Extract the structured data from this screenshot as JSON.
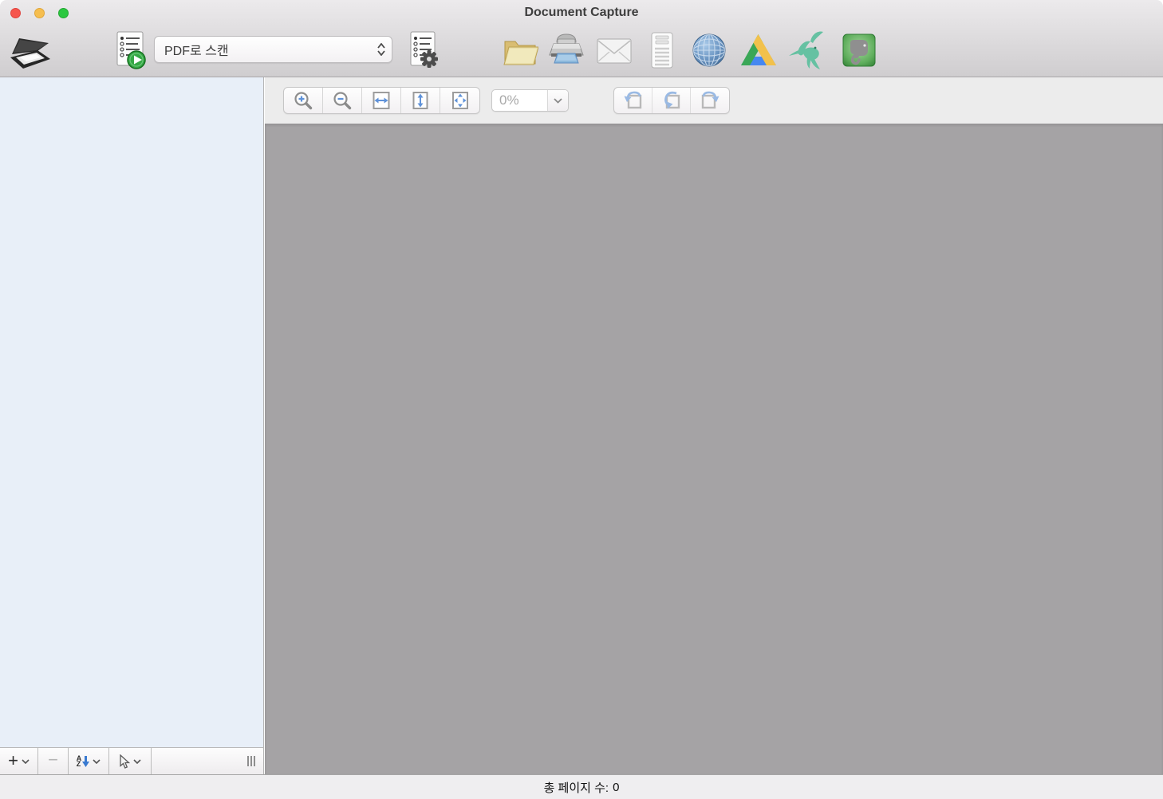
{
  "window": {
    "title": "Document Capture",
    "traffic_lights": {
      "close_color": "#f6554d",
      "minimize_color": "#f6be4f",
      "zoom_color": "#2bc840"
    }
  },
  "toolbar": {
    "scan_button": {
      "icon": "scanner-icon"
    },
    "run_job_button": {
      "icon": "job-run-icon"
    },
    "job_select": {
      "value": "PDF로 스캔"
    },
    "job_settings_button": {
      "icon": "job-settings-icon"
    },
    "destinations": [
      {
        "name": "save-to-folder",
        "icon": "folder-icon",
        "color": "#e8d28e"
      },
      {
        "name": "print",
        "icon": "printer-icon",
        "color": "#9a9a9a"
      },
      {
        "name": "attach-to-email",
        "icon": "envelope-icon",
        "color": "#efefef"
      },
      {
        "name": "send-to-application",
        "icon": "application-icon",
        "color": "#f5f5f5"
      },
      {
        "name": "send-to-web",
        "icon": "globe-icon",
        "color": "#5d8cc0"
      },
      {
        "name": "google-drive",
        "icon": "google-drive-icon",
        "colors": [
          "#3aa757",
          "#f2c14b",
          "#4688f1"
        ]
      },
      {
        "name": "hummingbird-service",
        "icon": "hummingbird-icon",
        "color": "#66c1a2"
      },
      {
        "name": "evernote",
        "icon": "evernote-icon",
        "color": "#57a557"
      }
    ]
  },
  "preview_toolbar": {
    "zoom_in": {
      "icon": "zoom-in-icon"
    },
    "zoom_out": {
      "icon": "zoom-out-icon"
    },
    "fit_width": {
      "icon": "fit-width-icon"
    },
    "fit_height": {
      "icon": "fit-height-icon"
    },
    "fit_page": {
      "icon": "fit-page-icon"
    },
    "zoom_value": "0%",
    "rotate_left": {
      "icon": "rotate-left-icon"
    },
    "rotate_180": {
      "icon": "rotate-180-icon"
    },
    "rotate_right": {
      "icon": "rotate-right-icon"
    }
  },
  "thumbnail_toolbar": {
    "add_label": "+",
    "remove_label": "−",
    "sort_letter_a": "A",
    "sort_letter_z": "Z",
    "pointer_icon": "pointer-icon",
    "grip_icon": "drag-grip-icon"
  },
  "status_bar": {
    "label": "총 페이지 수:",
    "value": "0"
  },
  "colors": {
    "sidebar_bg": "#e8eff8",
    "preview_bg": "#a5a3a5",
    "toolbar_bg": "#ececec",
    "accent_blue": "#6b98d8"
  }
}
